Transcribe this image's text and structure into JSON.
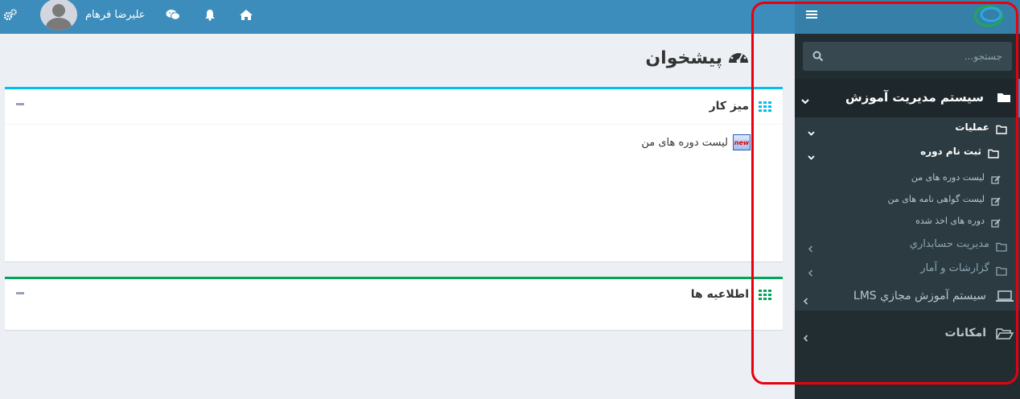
{
  "header": {
    "user_name": "عليرضا فرهام",
    "icons": [
      "settings-icon",
      "wechat-icon",
      "bell-icon",
      "home-icon"
    ],
    "brand_color": "#3c8dbc"
  },
  "sidebar": {
    "search_placeholder": "جستجو...",
    "menu": {
      "lms_admin": "سیستم مدیریت آموزش",
      "operations": "عملیات",
      "course_registration": "ثبت نام دوره",
      "my_courses": "لیست دوره های من",
      "my_certificates": "لیست گواهی نامه های من",
      "taken_courses": "دوره های اخذ شده",
      "accounting": "مديريت حسابداري",
      "reports": "گزارشات و آمار",
      "virtual_lms": "سيستم آموزش مجازي LMS",
      "facilities": "امکانات"
    },
    "bg_color": "#222d32"
  },
  "main": {
    "page_title": "پیشخوان",
    "desk_box": {
      "title": "میز کار",
      "link": "لیست دوره های من",
      "badge": "new",
      "accent": "#00c0ef"
    },
    "news_box": {
      "title": "اطلاعیه ها",
      "accent": "#00a65a"
    }
  }
}
